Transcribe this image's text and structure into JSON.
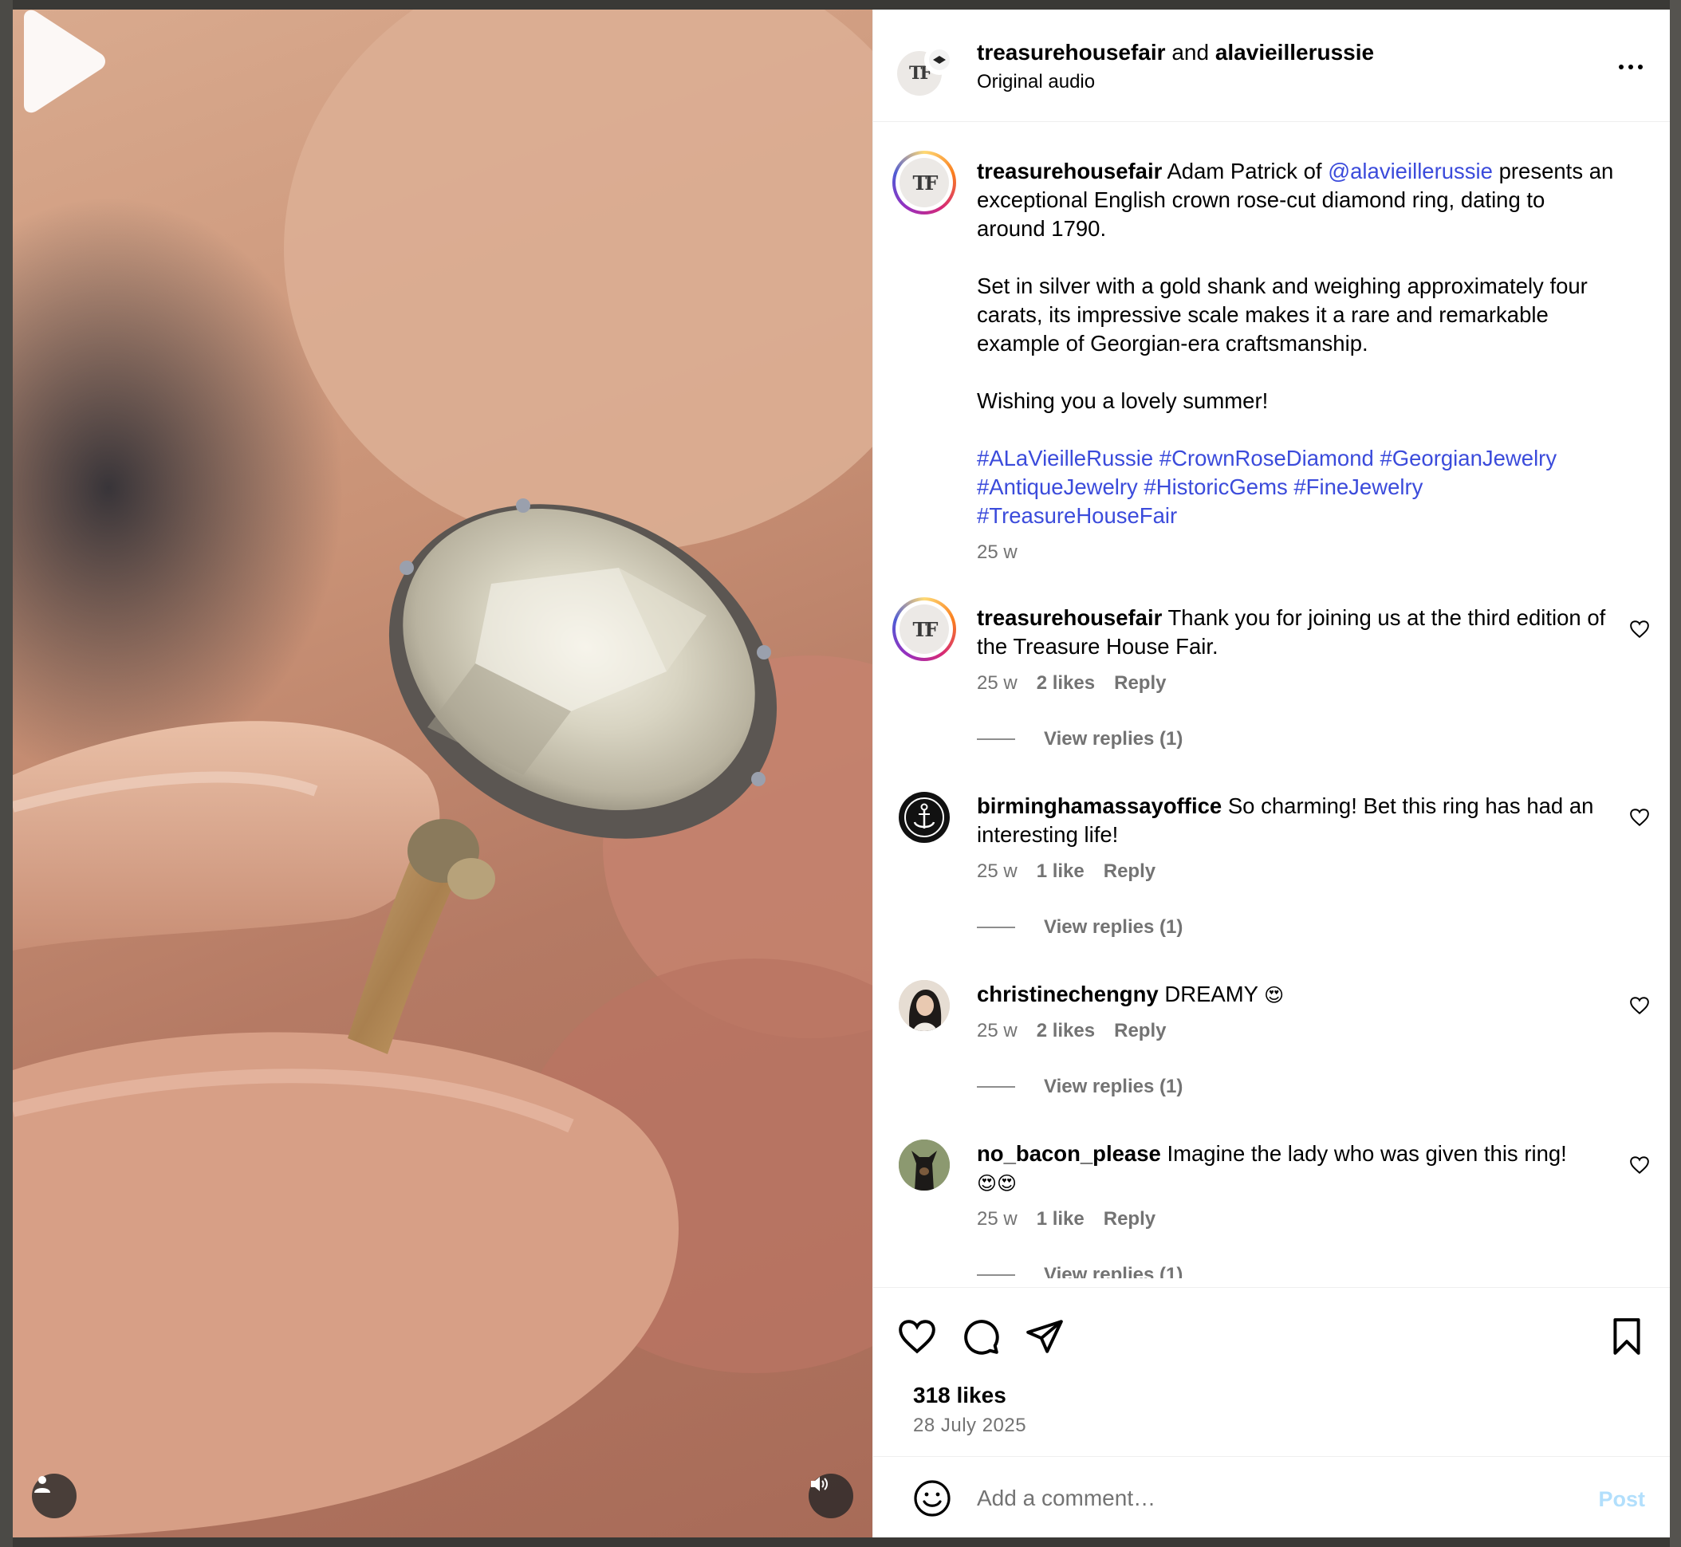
{
  "header": {
    "author": "treasurehousefair",
    "joiner": "and",
    "collaborator": "alavieillerussie",
    "subtitle": "Original audio",
    "avatar_monogram": "TF"
  },
  "caption": {
    "username": "treasurehousefair",
    "text_part1": "Adam Patrick of",
    "mention": "@alavieillerussie",
    "text_part2": "presents an exceptional English crown rose-cut diamond ring, dating to around 1790.",
    "paragraph2": "Set in silver with a gold shank and weighing approximately four carats, its impressive scale makes it a rare and remarkable example of Georgian-era craftsmanship.",
    "paragraph3": "Wishing you a lovely summer!",
    "hashtags": [
      "#ALaVieilleRussie",
      "#CrownRoseDiamond",
      "#GeorgianJewelry",
      "#AntiqueJewelry",
      "#HistoricGems",
      "#FineJewelry",
      "#TreasureHouseFair"
    ],
    "time": "25 w"
  },
  "comments": [
    {
      "username": "treasurehousefair",
      "text": "Thank you for joining us at the third edition of the Treasure House Fair.",
      "time": "25 w",
      "likes": "2 likes",
      "reply": "Reply",
      "view_replies": "View replies (1)"
    },
    {
      "username": "birminghamassayoffice",
      "text": "So charming! Bet this ring has had an interesting life!",
      "time": "25 w",
      "likes": "1 like",
      "reply": "Reply",
      "view_replies": "View replies (1)"
    },
    {
      "username": "christinechengny",
      "text": "DREAMY",
      "emoji": "😍",
      "time": "25 w",
      "likes": "2 likes",
      "reply": "Reply",
      "view_replies": "View replies (1)"
    },
    {
      "username": "no_bacon_please",
      "text": "Imagine the lady who was given this ring!",
      "emoji": "😍😍",
      "time": "25 w",
      "likes": "1 like",
      "reply": "Reply",
      "view_replies": "View replies (1)"
    }
  ],
  "actions": {
    "icons": [
      "heart-icon",
      "comment-icon",
      "share-icon",
      "bookmark-icon"
    ],
    "likes": "318 likes",
    "date": "28 July 2025"
  },
  "composer": {
    "emoji_icon": "smiley-icon",
    "placeholder": "Add a comment…",
    "post_label": "Post"
  },
  "colors": {
    "link": "#3b4bdb",
    "secondary_text": "#737373",
    "post_button": "#b2dffc"
  }
}
